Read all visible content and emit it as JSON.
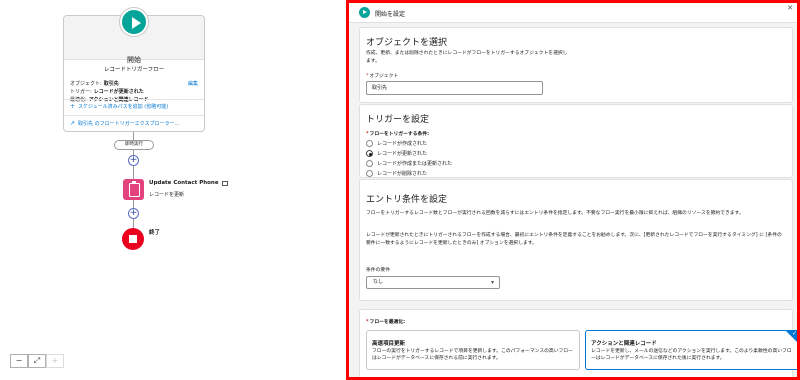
{
  "canvas": {
    "start": {
      "title": "開始",
      "subtitle": "レコードトリガーフロー",
      "details": [
        {
          "label": "オブジェクト:",
          "value": "取引先"
        },
        {
          "label": "トリガー:",
          "value": "レコードが更新された"
        },
        {
          "label": "最適化:",
          "value": "アクションと関連レコード"
        }
      ],
      "edit_label": "編集",
      "links": [
        {
          "icon": "plus-icon",
          "text": "スケジュール済みパスを追加 (省略可能)"
        },
        {
          "icon": "external-link-icon",
          "text": "取引先 のフロートリガーエクスプローラー..."
        }
      ]
    },
    "immediate_label": "即時実行",
    "action": {
      "title": "Update Contact Phone",
      "subtitle": "レコードを更新"
    },
    "end_label": "終了",
    "zoom": {
      "zoom_out": "−",
      "fit": "⤢",
      "zoom_in": "+"
    }
  },
  "panel": {
    "title": "開始を設定",
    "close_icon": "close-icon",
    "object_section": {
      "heading": "オブジェクトを選択",
      "description": "作成、更新、または削除されたときにレコードがフローをトリガーするオブジェクトを選択します。",
      "field_label": "オブジェクト",
      "field_value": "取引先"
    },
    "trigger_section": {
      "heading": "トリガーを設定",
      "field_label": "フローをトリガーする条件:",
      "options": [
        {
          "label": "レコードが作成された",
          "selected": false
        },
        {
          "label": "レコードが更新された",
          "selected": true
        },
        {
          "label": "レコードが作成または更新された",
          "selected": false
        },
        {
          "label": "レコードが削除された",
          "selected": false
        }
      ]
    },
    "entry_section": {
      "heading": "エントリ条件を設定",
      "description1": "フローをトリガーするレコード数とフローが実行される回数を減らすにはエントリ条件を指定します。不要なフロー実行を最小限に抑えれば、組織のリソースを節約できます。",
      "description2": "レコードが更新されたときにトリガーされるフローを作成する場合、最初にエントリ条件を定義することをお勧めします。次に、[更新されたレコードでフローを実行するタイミング] に [条件の要件に一致するようにレコードを更新したときのみ] オプションを選択します。",
      "requirement_label": "条件の要件",
      "requirement_value": "なし"
    },
    "optimize_section": {
      "field_label": "フローを最適化:",
      "options": [
        {
          "title": "高速項目更新",
          "description": "フローの実行をトリガーするレコードで項目を更新します。このパフォーマンスの高いフローはレコードがデータベースに保存される前に実行されます。",
          "selected": false
        },
        {
          "title": "アクションと関連レコード",
          "description": "レコードを更新し、メールの送信などのアクションを実行します。このより柔軟性の高いフローはレコードがデータベースに保存された後に実行されます。",
          "selected": true
        }
      ]
    }
  }
}
